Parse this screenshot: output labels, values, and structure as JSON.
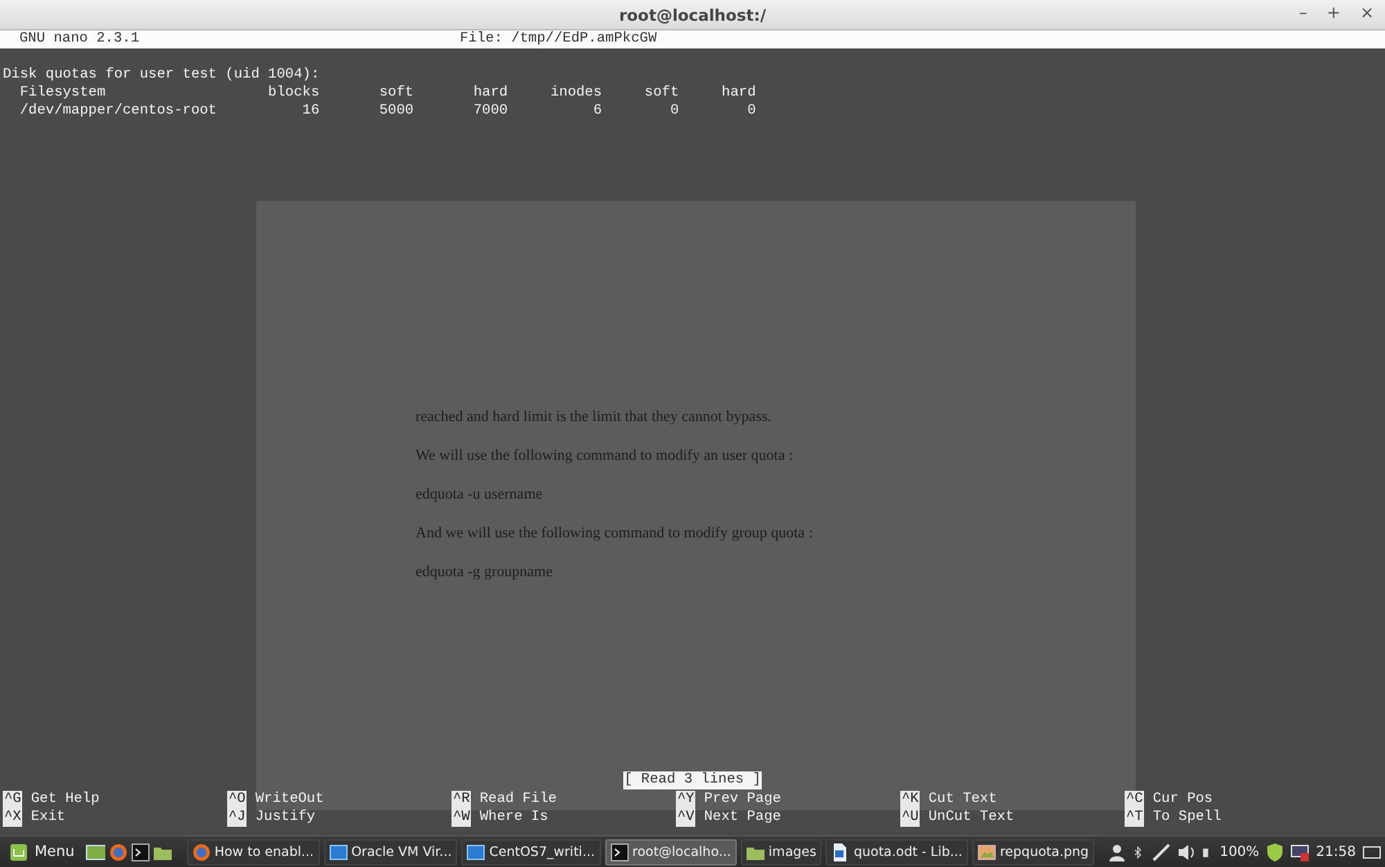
{
  "window": {
    "title": "root@localhost:/",
    "controls": [
      "–",
      "+",
      "×"
    ]
  },
  "nano": {
    "version": "GNU nano 2.3.1",
    "file": "File: /tmp//EdP.amPkcGW",
    "lines": [
      "Disk quotas for user test (uid 1004):",
      "  Filesystem                   blocks       soft       hard     inodes     soft     hard",
      "  /dev/mapper/centos-root          16       5000       7000          6        0        0"
    ],
    "status": "[ Read 3 lines ]",
    "shortcuts": [
      [
        {
          "key": "^G",
          "label": "Get Help"
        },
        {
          "key": "^O",
          "label": "WriteOut"
        },
        {
          "key": "^R",
          "label": "Read File"
        },
        {
          "key": "^Y",
          "label": "Prev Page"
        },
        {
          "key": "^K",
          "label": "Cut Text"
        },
        {
          "key": "^C",
          "label": "Cur Pos"
        }
      ],
      [
        {
          "key": "^X",
          "label": "Exit"
        },
        {
          "key": "^J",
          "label": "Justify"
        },
        {
          "key": "^W",
          "label": "Where Is"
        },
        {
          "key": "^V",
          "label": "Next Page"
        },
        {
          "key": "^U",
          "label": "UnCut Text"
        },
        {
          "key": "^T",
          "label": "To Spell"
        }
      ]
    ]
  },
  "background_document": {
    "paragraphs": [
      "reached and hard limit is the limit that they cannot bypass.",
      "We will use the following command to modify an user quota :",
      "edquota -u username",
      "And we will use the following command to modify group quota :",
      "edquota -g groupname"
    ]
  },
  "taskbar": {
    "menu": "Menu",
    "tasks": [
      {
        "label": "How to enabl...",
        "kind": "browser",
        "selected": false
      },
      {
        "label": "Oracle VM Vir...",
        "kind": "vm",
        "selected": false
      },
      {
        "label": "CentOS7_writi...",
        "kind": "vm",
        "selected": false
      },
      {
        "label": "root@localho...",
        "kind": "terminal",
        "selected": true
      },
      {
        "label": "images",
        "kind": "folder",
        "selected": false
      },
      {
        "label": "quota.odt - Lib...",
        "kind": "document",
        "selected": false
      },
      {
        "label": "repquota.png",
        "kind": "image",
        "selected": false
      }
    ],
    "battery": "100%",
    "clock": "21:58"
  }
}
